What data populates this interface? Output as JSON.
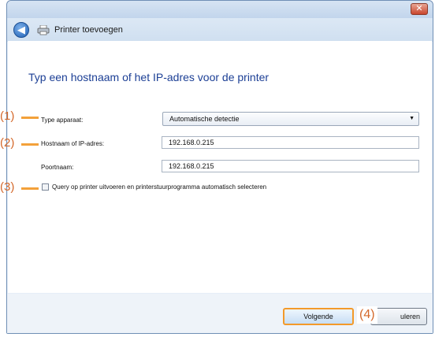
{
  "window": {
    "close_glyph": "✕"
  },
  "navbar": {
    "back_glyph": "◀",
    "title": "Printer toevoegen"
  },
  "main": {
    "heading": "Typ een hostnaam of het IP-adres voor de printer",
    "device_type_label": "Type apparaat:",
    "device_type_value": "Automatische detectie",
    "hostname_label": "Hostnaam of IP-adres:",
    "hostname_value": "192.168.0.215",
    "portname_label": "Poortnaam:",
    "portname_value": "192.168.0.215",
    "query_checkbox_label": "Query op printer uitvoeren en printerstuurprogramma automatisch selecteren",
    "query_checked": false
  },
  "footer": {
    "next_label": "Volgende",
    "cancel_label": "uleren"
  },
  "callouts": {
    "c1": "(1)",
    "c2": "(2)",
    "c3": "(3)",
    "c4": "(4)"
  },
  "icons": {
    "back": "back-arrow-icon",
    "printer": "printer-icon",
    "close": "close-icon",
    "dropdown": "chevron-down-icon"
  },
  "colors": {
    "heading": "#1c3f95",
    "callout": "#d4682a",
    "callout_line": "#f3a13a",
    "next_highlight": "#f39a2a",
    "window_frame": "#6f8fb5"
  }
}
